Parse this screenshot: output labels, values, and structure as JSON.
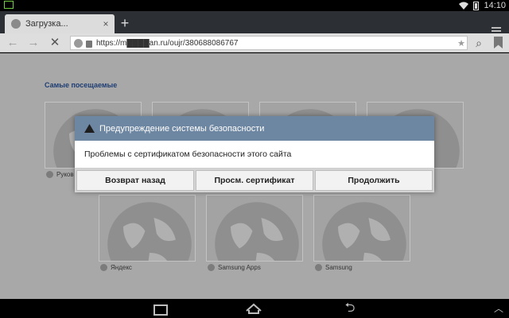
{
  "status_bar": {
    "time": "14:10"
  },
  "browser": {
    "tab": {
      "title": "Загрузка...",
      "close_label": "×"
    },
    "new_tab_label": "+",
    "url": "https://m████an.ru/oujr/380688086767",
    "toolbar": {
      "back_icon": "←",
      "forward_icon": "→",
      "stop_icon": "✕",
      "search_icon": "⌕"
    }
  },
  "page": {
    "section_title": "Самые посещаемые",
    "thumbnails_top": [
      {
        "label": "Руков"
      },
      {
        "label": ""
      },
      {
        "label": ""
      },
      {
        "label": ""
      }
    ],
    "thumbnails_bottom": [
      {
        "label": "Яндекс"
      },
      {
        "label": "Samsung Apps"
      },
      {
        "label": "Samsung"
      }
    ]
  },
  "dialog": {
    "title": "Предупреждение системы безопасности",
    "message": "Проблемы с сертификатом безопасности этого сайта",
    "buttons": {
      "back": "Возврат назад",
      "view_certificate": "Просм. сертификат",
      "continue": "Продолжить"
    }
  }
}
